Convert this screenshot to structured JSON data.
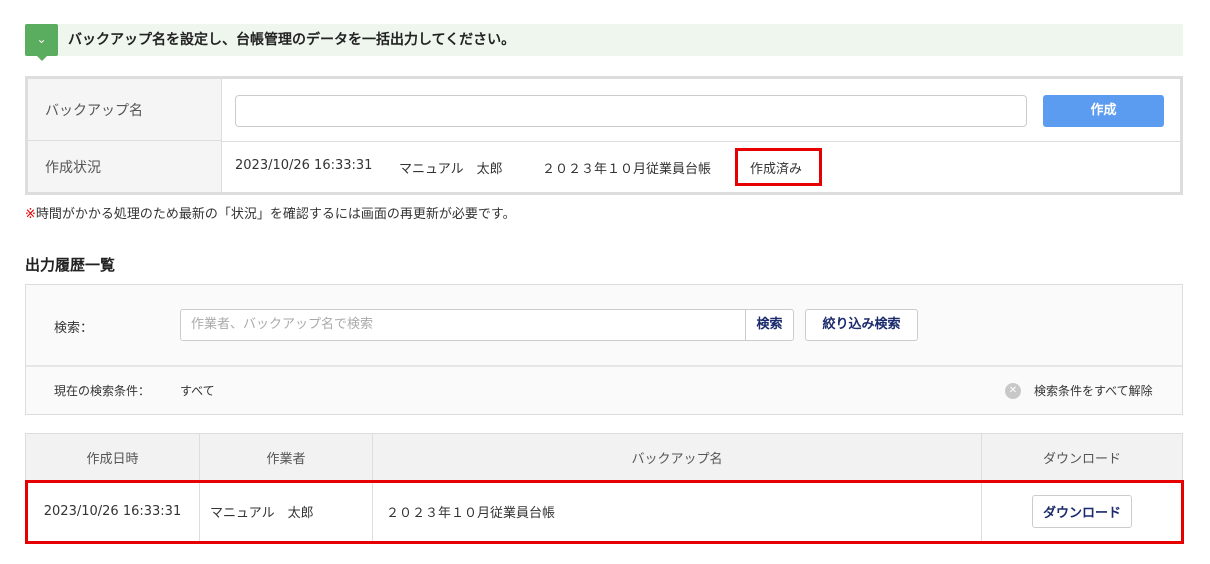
{
  "banner": {
    "text": "バックアップ名を設定し、台帳管理のデータを一括出力してください。"
  },
  "form": {
    "name_label": "バックアップ名",
    "name_value": "",
    "create_button": "作成",
    "status_label": "作成状況",
    "status_date": "2023/10/26 16:33:31",
    "status_user": "マニュアル　太郎",
    "status_name": "２０２３年１０月従業員台帳",
    "status_state": "作成済み"
  },
  "note": {
    "mark": "※",
    "text": "時間がかかる処理のため最新の「状況」を確認するには画面の再更新が必要です。"
  },
  "history": {
    "title": "出力履歴一覧",
    "search_label": "検索：",
    "search_placeholder": "作業者、バックアップ名で検索",
    "search_button": "検索",
    "filter_button": "絞り込み検索",
    "cond_label": "現在の検索条件：",
    "cond_value": "すべて",
    "clear_label": "検索条件をすべて解除",
    "columns": [
      "作成日時",
      "作業者",
      "バックアップ名",
      "ダウンロード"
    ],
    "rows": [
      {
        "date": "2023/10/26 16:33:31",
        "user": "マニュアル　太郎",
        "name": "２０２３年１０月従業員台帳",
        "download": "ダウンロード"
      }
    ]
  }
}
